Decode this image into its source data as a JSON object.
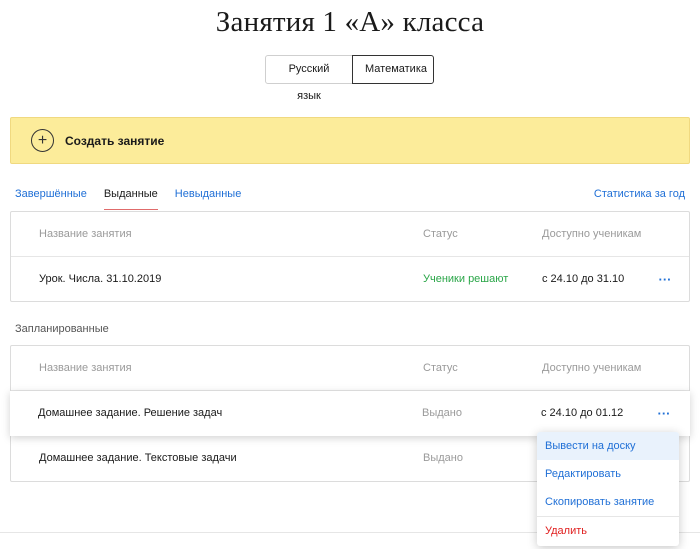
{
  "page": {
    "title": "Занятия 1 «А» класса"
  },
  "subjects": [
    {
      "label": "Русский язык",
      "active": false
    },
    {
      "label": "Математика",
      "active": true
    }
  ],
  "create": {
    "label": "Создать занятие",
    "icon": "plus-icon"
  },
  "tabs": [
    {
      "label": "Завершённые",
      "active": false
    },
    {
      "label": "Выданные",
      "active": true
    },
    {
      "label": "Невыданные",
      "active": false
    }
  ],
  "stats_link": "Статистика за год",
  "columns": {
    "name": "Название занятия",
    "status": "Статус",
    "available": "Доступно ученикам"
  },
  "issued": {
    "rows": [
      {
        "name": "Урок. Числа. 31.10.2019",
        "status": "Ученики решают",
        "available": "с 24.10 до 31.10",
        "more": "···"
      }
    ]
  },
  "planned": {
    "label": "Запланированные",
    "rows": [
      {
        "name": "Домашнее задание. Решение задач",
        "status": "Выдано",
        "available": "с 24.10 до 01.12",
        "more": "···"
      },
      {
        "name": "Домашнее задание. Текстовые задачи",
        "status": "Выдано",
        "available": "",
        "more": ""
      }
    ]
  },
  "menu": {
    "items": [
      {
        "label": "Вывести на доску"
      },
      {
        "label": "Редактировать"
      },
      {
        "label": "Скопировать занятие"
      },
      {
        "label": "Удалить"
      }
    ]
  },
  "colors": {
    "accent": "#1f6fd6",
    "banner": "#fcec9a",
    "success": "#2aa648",
    "danger": "#e02020",
    "tab_underline": "#e06b6b"
  }
}
